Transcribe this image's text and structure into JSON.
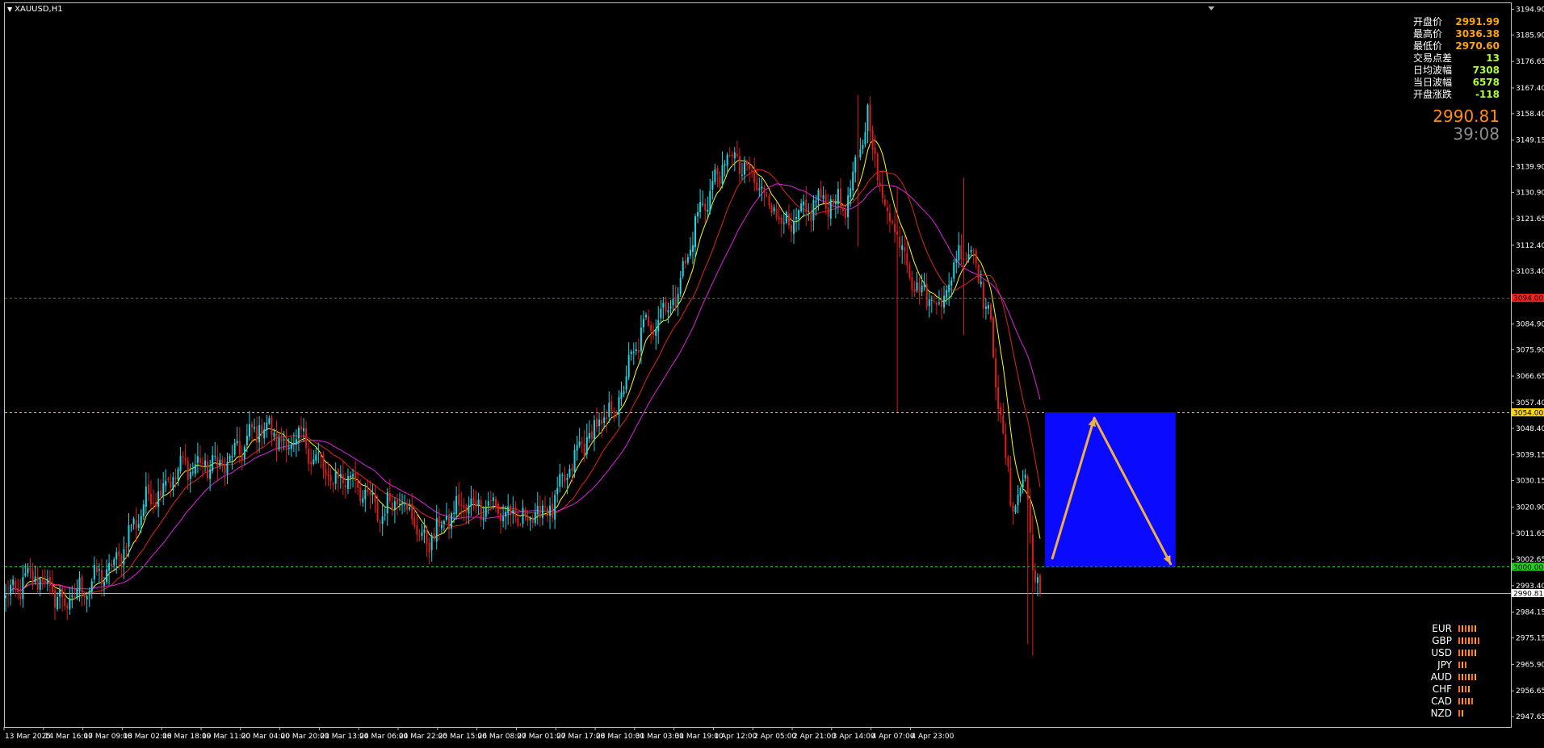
{
  "chart_data": {
    "type": "candlestick",
    "symbol": "XAUUSD,H1",
    "y_axis_ticks": [
      3194.9,
      3185.9,
      3176.65,
      3167.4,
      3158.4,
      3149.15,
      3139.9,
      3130.9,
      3121.65,
      3112.4,
      3103.4,
      3094.15,
      3084.9,
      3075.9,
      3066.65,
      3057.4,
      3048.4,
      3039.15,
      3030.15,
      3020.9,
      3011.65,
      3002.65,
      2993.4,
      2984.15,
      2975.15,
      2965.9,
      2956.65,
      2947.65
    ],
    "ylim": [
      2944.0,
      3197.0
    ],
    "x_axis_labels": [
      "13 Mar 2025",
      "14 Mar 16:00",
      "17 Mar 09:00",
      "18 Mar 02:00",
      "18 Mar 18:00",
      "19 Mar 11:00",
      "20 Mar 04:00",
      "20 Mar 20:00",
      "21 Mar 13:00",
      "24 Mar 06:00",
      "24 Mar 22:00",
      "25 Mar 15:00",
      "26 Mar 08:00",
      "27 Mar 01:00",
      "27 Mar 17:00",
      "28 Mar 10:00",
      "31 Mar 03:00",
      "31 Mar 19:00",
      "1 Apr 12:00",
      "2 Apr 05:00",
      "2 Apr 21:00",
      "3 Apr 14:00",
      "4 Apr 07:00",
      "4 Apr 23:00"
    ],
    "bars_between_labels": 16,
    "total_bars": 370,
    "price_path": [
      [
        0,
        2989
      ],
      [
        12,
        2997
      ],
      [
        24,
        2987
      ],
      [
        32,
        2993
      ],
      [
        44,
        3000
      ],
      [
        56,
        3022
      ],
      [
        72,
        3035
      ],
      [
        90,
        3036
      ],
      [
        104,
        3050
      ],
      [
        114,
        3042
      ],
      [
        120,
        3045
      ],
      [
        132,
        3030
      ],
      [
        140,
        3032
      ],
      [
        152,
        3018
      ],
      [
        160,
        3026
      ],
      [
        170,
        3008
      ],
      [
        184,
        3021
      ],
      [
        196,
        3022
      ],
      [
        208,
        3016
      ],
      [
        222,
        3021
      ],
      [
        234,
        3043
      ],
      [
        248,
        3056
      ],
      [
        258,
        3082
      ],
      [
        272,
        3094
      ],
      [
        282,
        3125
      ],
      [
        294,
        3144
      ],
      [
        306,
        3133
      ],
      [
        318,
        3118
      ],
      [
        330,
        3128
      ],
      [
        342,
        3127
      ],
      [
        350,
        3158
      ],
      [
        356,
        3128
      ],
      [
        362,
        3117
      ],
      [
        370,
        3097
      ],
      [
        380,
        3092
      ],
      [
        388,
        3112
      ],
      [
        394,
        3108
      ],
      [
        400,
        3082
      ],
      [
        408,
        3022
      ],
      [
        414,
        3030
      ],
      [
        418,
        2996
      ],
      [
        420,
        2991
      ]
    ],
    "spikes": [
      {
        "bar": 346,
        "high": 3165,
        "low": 3112
      },
      {
        "bar": 362,
        "high": 3133,
        "low": 3054
      },
      {
        "bar": 389,
        "high": 3136,
        "low": 3081
      },
      {
        "bar": 415,
        "high": 3013,
        "low": 2973
      },
      {
        "bar": 417,
        "high": 3018,
        "low": 2969
      }
    ],
    "moving_averages": [
      {
        "color": "#ffff00",
        "period": 8
      },
      {
        "color": "#e0241b",
        "period": 20
      },
      {
        "color": "#e020e0",
        "period": 34
      }
    ],
    "last_price": 2990.81,
    "horizontal_lines": [
      {
        "price": 3094.0,
        "color": "#ff2020",
        "label": "3094.00",
        "tag_bg": "#ff2020",
        "tag_fg": "#000000"
      },
      {
        "price": 3054.0,
        "color": "#ffd700",
        "label": "3054.00",
        "tag_bg": "#ffd700",
        "tag_fg": "#000000"
      },
      {
        "price": 3000.0,
        "color": "#2ecc40",
        "label": "3000.00",
        "tag_bg": "#1fd01f",
        "tag_fg": "#000000"
      },
      {
        "price": 2990.81,
        "color": "#a8b8c8",
        "label": "2990.81",
        "tag_bg": "#ffffff",
        "tag_fg": "#000000",
        "solid": true
      }
    ],
    "projection_box": {
      "bar_start": 422,
      "bar_end": 475,
      "price_high": 3054,
      "price_low": 3000,
      "color": "#0a0aff"
    },
    "projection_arrows": [
      {
        "from": [
          425,
          3003
        ],
        "to": [
          442,
          3052
        ],
        "color": "#f0b040"
      },
      {
        "from": [
          442,
          3052
        ],
        "to": [
          473,
          3001
        ],
        "color": "#f0b040"
      }
    ]
  },
  "info_panel": {
    "rows": [
      {
        "label": "开盘价",
        "value": "2991.99",
        "color": "#ffa500"
      },
      {
        "label": "最高价",
        "value": "3036.38",
        "color": "#ffa500"
      },
      {
        "label": "最低价",
        "value": "2970.60",
        "color": "#ffa500"
      },
      {
        "label": "交易点差",
        "value": "13",
        "color": "#adff2f"
      },
      {
        "label": "日均波幅",
        "value": "7308",
        "color": "#adff2f"
      },
      {
        "label": "当日波幅",
        "value": "6578",
        "color": "#adff2f"
      },
      {
        "label": "开盘涨跌",
        "value": "-118",
        "color": "#adff2f"
      }
    ],
    "bid": "2990.81",
    "timer": "39:08"
  },
  "currency_strength": [
    {
      "code": "EUR",
      "bars": 6
    },
    {
      "code": "GBP",
      "bars": 7
    },
    {
      "code": "USD",
      "bars": 6
    },
    {
      "code": "JPY",
      "bars": 3
    },
    {
      "code": "AUD",
      "bars": 6
    },
    {
      "code": "CHF",
      "bars": 4
    },
    {
      "code": "CAD",
      "bars": 5
    },
    {
      "code": "NZD",
      "bars": 2
    }
  ]
}
